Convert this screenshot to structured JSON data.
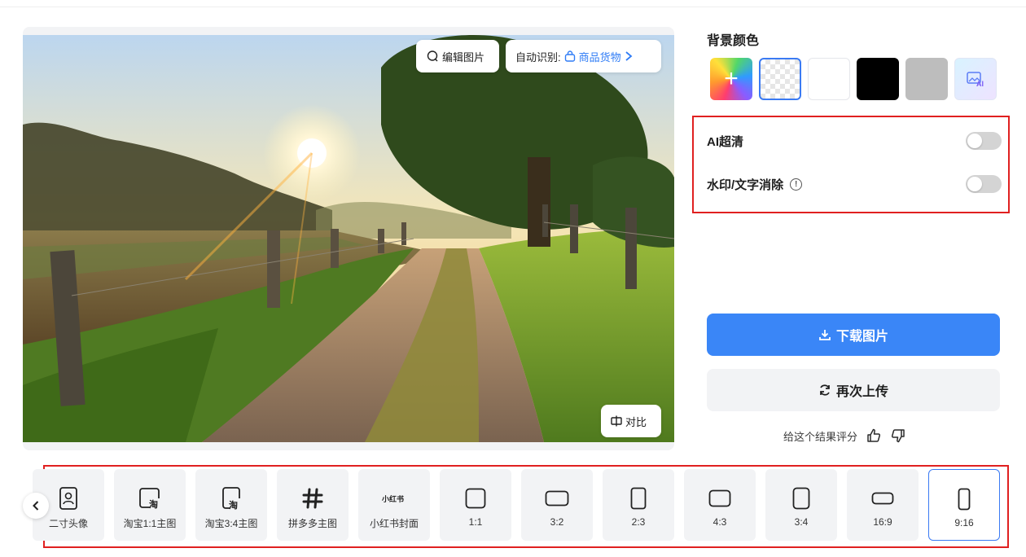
{
  "preview": {
    "edit_label": "编辑图片",
    "auto_detect_label": "自动识别:",
    "auto_detect_value": "商品货物",
    "compare_label": "对比"
  },
  "panel": {
    "bg_title": "背景颜色",
    "swatches": [
      {
        "name": "custom",
        "color": "gradient"
      },
      {
        "name": "transparent",
        "color": "checker"
      },
      {
        "name": "white",
        "color": "#ffffff"
      },
      {
        "name": "black",
        "color": "#000000"
      },
      {
        "name": "gray",
        "color": "#bdbdbd"
      },
      {
        "name": "ai",
        "color": "gradient"
      }
    ],
    "ai_hd_label": "AI超清",
    "watermark_label": "水印/文字消除",
    "ai_hd_on": false,
    "watermark_on": false,
    "download_label": "下载图片",
    "reupload_label": "再次上传",
    "rating_label": "给这个结果评分"
  },
  "presets": [
    {
      "label": "二寸头像",
      "icon": "portrait-icon"
    },
    {
      "label": "淘宝1:1主图",
      "icon": "taobao-square-icon"
    },
    {
      "label": "淘宝3:4主图",
      "icon": "taobao-portrait-icon"
    },
    {
      "label": "拼多多主图",
      "icon": "pinduoduo-icon"
    },
    {
      "label": "小红书封面",
      "icon": "xiaohongshu-icon"
    },
    {
      "label": "1:1",
      "icon": "ratio-1-1-icon"
    },
    {
      "label": "3:2",
      "icon": "ratio-3-2-icon"
    },
    {
      "label": "2:3",
      "icon": "ratio-2-3-icon"
    },
    {
      "label": "4:3",
      "icon": "ratio-4-3-icon"
    },
    {
      "label": "3:4",
      "icon": "ratio-3-4-icon"
    },
    {
      "label": "16:9",
      "icon": "ratio-16-9-icon"
    },
    {
      "label": "9:16",
      "icon": "ratio-9-16-icon"
    }
  ],
  "selected_preset": "9:16",
  "colors": {
    "accent": "#3a86f7",
    "highlight_border": "#e02020"
  }
}
